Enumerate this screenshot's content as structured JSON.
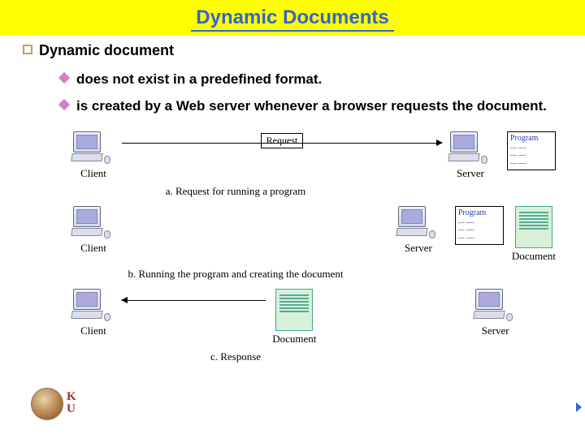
{
  "title": "Dynamic Documents",
  "bullets": {
    "lvl1": "Dynamic document",
    "sub1": "does not exist in a predefined format.",
    "sub2": "is created by a Web server whenever a browser requests the document."
  },
  "diagram": {
    "client": "Client",
    "server": "Server",
    "request_label": "Request",
    "program_label": "Program",
    "document_label": "Document",
    "caption_a": "a. Request for running a program",
    "caption_b": "b. Running the program and creating the document",
    "caption_c": "c. Response"
  },
  "footer": {
    "k": "K",
    "u": "U"
  }
}
